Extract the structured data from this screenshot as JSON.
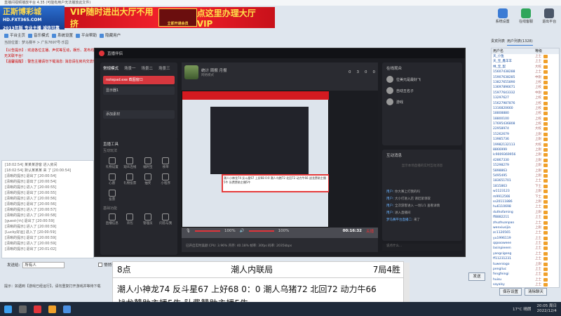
{
  "app": {
    "title": "直播间视频播放平台 4.35 (可能有用户无法播放此文件)"
  },
  "banner": {
    "logo_main": "正斯博彩城",
    "logo_site": "HD.FXT365.COM",
    "logo_tag": "2013年版 专业主播 诚信可靠",
    "ad_left": "VIP随时进出大厅不用挤",
    "ad_mid": "立即开通会员",
    "ad_right": "点这里办理大厅VIP"
  },
  "right_tools": [
    {
      "label": "系统设置",
      "icon": "gear-icon"
    },
    {
      "label": "在线客服",
      "icon": "chat-icon"
    },
    {
      "label": "退出平台",
      "icon": "exit-icon"
    }
  ],
  "nav": [
    "平台主页",
    "音乐模式",
    "系统设置",
    "平台帮助",
    "隐藏用户"
  ],
  "breadcrumb": "当前位置：梦马赛平 > 广东7697号·乐园",
  "notice": [
    "【公告提示】: 欢迎各位主播、声优等互动，娱乐、发布均无关联平台!",
    "【温馨提醒】: 警告主播请勿下载消息: 消息请在房内交流!"
  ],
  "chatlog": [
    "[18:02:54] 某某某游客 进入房间",
    "[18:02:54] 默认某某某 来 了 [20:00:54]",
    "[清晰的提示] 退出了 [20:00:54]",
    "[清晰的提示] 退出了 [20:00:54]",
    "[清晰的提示] 进入了 [20:00:55]",
    "[清晰的提示] 退出了 [20:00:55]",
    "[清晰的提示] 进入了 [20:00:56]",
    "[清晰的提示] 退出了 [20:00:56]",
    "[清晰的提示] 进入了 [20:00:57]",
    "[清晰的提示] 进入了 [20:00:58]",
    "[guest小h] 退出了 [20:00:59]",
    "[清晰的提示] 进入了 [20:00:59]",
    "[Lucky好运] 进入了 [20:00:59]",
    "[清晰的提示] 退出了 [20:00:59]",
    "[清晰的提示] 进入了 [20:00:59]",
    "[清晰的提示] 退出了 [20:01:02]"
  ],
  "sendbar": {
    "label": "发送给:",
    "target": "所有人",
    "private": "悄悄话"
  },
  "tip": "提示：如遇到【游戏已经运行】，请勿重复打开游戏并等待下载",
  "user_tabs": [
    "贵宾列表",
    "用户列表(1328)"
  ],
  "user_header": [
    "用户名",
    "等级"
  ],
  "users": [
    [
      "天_小鱼",
      "上士"
    ],
    [
      "天_宝_鑫羊羊",
      "上士"
    ],
    [
      "林_宝_梨",
      "大校"
    ],
    [
      "15607438288",
      "上士"
    ],
    [
      "15907638285",
      "中尉"
    ],
    [
      "13827655890",
      "上校"
    ],
    [
      "13697896671",
      "上校"
    ],
    [
      "15977643332",
      "中尉"
    ],
    [
      "13297627",
      "上校"
    ],
    [
      "15627987876",
      "上校"
    ],
    [
      "1316820660",
      "上校"
    ],
    [
      "18808880",
      "上校"
    ],
    [
      "18800100",
      "上校"
    ],
    [
      "17695436808",
      "上校"
    ],
    [
      "22958974",
      "大校"
    ],
    [
      "15262679",
      "上尉"
    ],
    [
      "13985736",
      "上尉"
    ],
    [
      "19982132113",
      "大校"
    ],
    [
      "8866999",
      "上尉"
    ],
    [
      "lc9009369956",
      "上尉"
    ],
    [
      "42867330",
      "上尉"
    ],
    [
      "15298279",
      "上尉"
    ],
    [
      "5898863",
      "上尉"
    ],
    [
      "5495495",
      "上尉"
    ],
    [
      "183651701",
      "上士"
    ],
    [
      "1815863",
      "下士"
    ],
    [
      "w1123123",
      "上尉"
    ],
    [
      "m9912566",
      "下士"
    ],
    [
      "ss20111886",
      "上尉"
    ],
    [
      "hu6110698",
      "上士"
    ],
    [
      "duthofaming",
      "上尉"
    ],
    [
      "ff8882211",
      "上士"
    ],
    [
      "zhuzhuanpao",
      "上士"
    ],
    [
      "wenxiusijia",
      "上尉"
    ],
    [
      "zc1120565",
      "上士"
    ],
    [
      "yu1996119",
      "上士"
    ],
    [
      "qqoooweee",
      "上士"
    ],
    [
      "lasinpieeen",
      "上士"
    ],
    [
      "yangcigong",
      "上士"
    ],
    [
      "ff11231231",
      "上士"
    ],
    [
      "tuweniogo",
      "上尉"
    ],
    [
      "pengliuc",
      "上士"
    ],
    [
      "fengfeingi",
      "上士"
    ],
    [
      "huisu",
      "上士"
    ],
    [
      "sayalsy",
      "上士"
    ],
    [
      "daouxiai",
      "上士"
    ],
    [
      "qqiann000",
      "上士"
    ]
  ],
  "buttons": {
    "send": "发送",
    "save": "保存设置",
    "clear": "清除聊天"
  },
  "stream": {
    "app": "直播伴侣",
    "tabs": [
      "常规模式",
      "场景一",
      "场景二",
      "场景三"
    ],
    "add_scene": "添加",
    "sources": [
      "notepad.exe 截图窗口",
      "显示器1"
    ],
    "add_source": "添加素材",
    "tools_title": "直播工具",
    "interaction_title": "互动玩法",
    "tools_row1": [
      "礼物设置",
      "观众连线",
      "福利宝",
      "榜单"
    ],
    "tools_row2": [
      "心愿",
      "礼物投票",
      "抽奖",
      "小程序"
    ],
    "tools_row3": [
      "投票"
    ],
    "tools2_title": "基础功能",
    "tools2": [
      "直播信息",
      "背包",
      "管理员",
      "问答与我"
    ],
    "room_name": "统计 周报 月报",
    "room_sub": "网络模式",
    "stats": [
      "0",
      "3",
      "0",
      "0"
    ],
    "host_label": "梦马赛平台直播二",
    "viewers_title": "在线观众",
    "viewers": [
      "位美元是最好飞",
      "自动五名子",
      "游戏"
    ],
    "messages_title": "互动消息",
    "messages_hint": "显示本场直播的实时互动消息",
    "messages": [
      [
        "用户:",
        "你大赛上打我的吗"
      ],
      [
        "用户:",
        "大小打进入店 请赶紧领取"
      ],
      [
        "用户:",
        "全次游客进入 一场1/1 查看详情"
      ],
      [
        "用户:",
        "进入直播间"
      ],
      [
        "梦马赛平台直播二:",
        "来了"
      ]
    ],
    "msg_input": "说点什么...",
    "vol1": "100%",
    "vol2": "100%",
    "timer": "00:16:32",
    "end_label": "关播",
    "status": "已开启实时美颜    CPU: 3.96%    内存: 40.18%    帧率: 30fps    码率: 2035kbps",
    "status2": "不知道在哪里开启直播伴侣?",
    "inner_overlay": "潮人小神龙74 反斗星67 上好68 0:0 潮人乌猪72 北回72 动力牛66 战龙赞助主播5牛 队费赞助主播5牛"
  },
  "score": {
    "left": "8点",
    "center": "潮人内联局",
    "right": "7局4胜",
    "line1": "潮人小神龙74  反斗星67  上好68    0：0  潮人乌猪72  北回72  动力牛66",
    "line2": "战龙赞助主播5牛    队费赞助主播5牛"
  },
  "taskbar": {
    "weather": "17°C 晴朗",
    "time": "20:05 周日",
    "date": "2022/12/4"
  },
  "colors": {
    "accent": "#d41a20",
    "brand_blue": "#2b6fd0",
    "dark_panel": "#1c1d22"
  }
}
